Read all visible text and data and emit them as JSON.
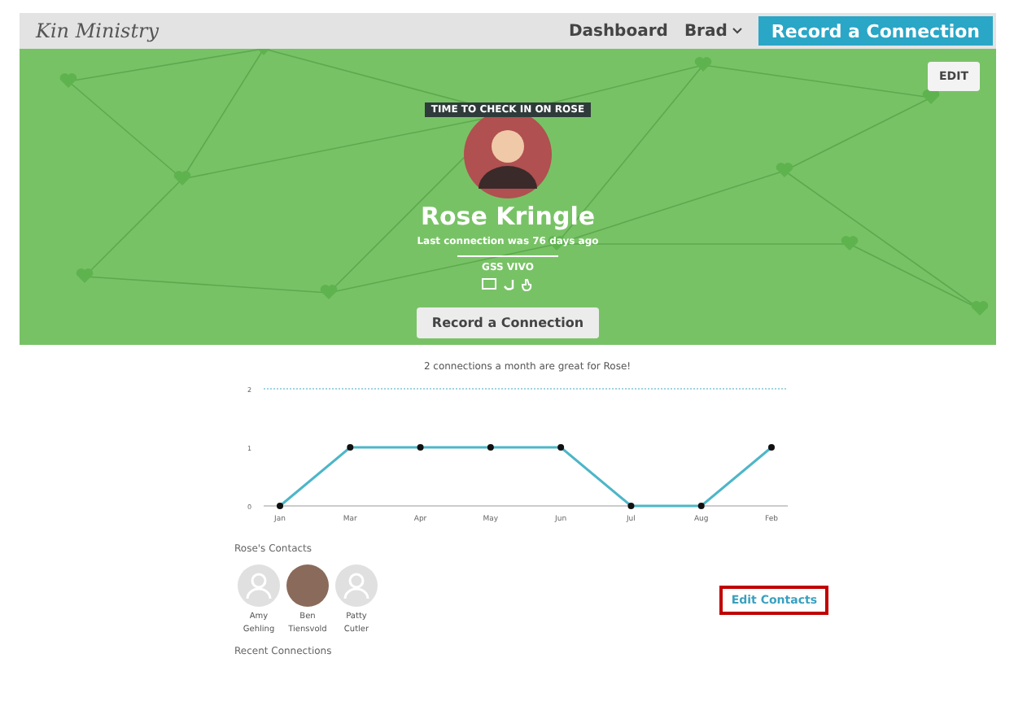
{
  "nav": {
    "logo": "Kin Ministry",
    "links": [
      {
        "label": "Dashboard"
      },
      {
        "label": "Brad",
        "dropdown": true
      }
    ],
    "cta": "Record a Connection"
  },
  "hero": {
    "edit_button": "EDIT",
    "banner": "TIME TO CHECK IN ON ROSE",
    "name": "Rose Kringle",
    "last_connection": "Last connection was 76 days ago",
    "subtitle": "GSS VIVO",
    "action_button": "Record a Connection"
  },
  "goal": {
    "title": "2 connections a month are great for Rose!",
    "chart_data": {
      "type": "line",
      "categories": [
        "Jan",
        "Mar",
        "Apr",
        "May",
        "Jun",
        "Jul",
        "Aug",
        "Feb"
      ],
      "series": [
        {
          "color": "#4db6c8",
          "marker": "circle",
          "values": [
            0,
            1,
            1,
            1,
            1,
            0,
            0,
            1
          ]
        }
      ],
      "ylim": [
        0,
        2
      ],
      "yticks": [
        0,
        1,
        2
      ]
    }
  },
  "contacts": {
    "heading": "Rose's Contacts",
    "items": [
      {
        "first": "Amy",
        "last": "Gehling",
        "kind": "placeholder"
      },
      {
        "first": "Ben",
        "last": "Tiensvold",
        "kind": "photo"
      },
      {
        "first": "Patty",
        "last": "Cutler",
        "kind": "placeholder"
      }
    ],
    "edit_link": {
      "label": "Edit Contacts",
      "highlighted": true
    }
  },
  "recent": {
    "heading": "Recent Connections"
  }
}
